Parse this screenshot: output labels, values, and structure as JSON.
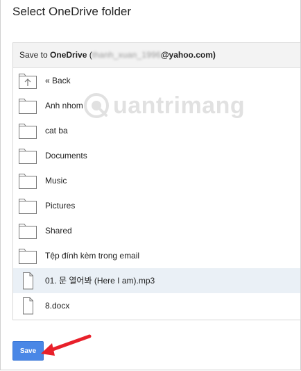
{
  "dialog": {
    "title": "Select OneDrive folder"
  },
  "header": {
    "prefix": "Save to ",
    "service": "OneDrive",
    "account_open": " (",
    "account_hidden": "thanh_xuan_1996",
    "account_domain": "@yahoo.com)"
  },
  "watermark": {
    "text": "uantrimang"
  },
  "items": [
    {
      "label": "« Back",
      "type": "back"
    },
    {
      "label": "Anh nhom",
      "type": "folder"
    },
    {
      "label": "cat ba",
      "type": "folder"
    },
    {
      "label": "Documents",
      "type": "folder"
    },
    {
      "label": "Music",
      "type": "folder"
    },
    {
      "label": "Pictures",
      "type": "folder"
    },
    {
      "label": "Shared",
      "type": "folder"
    },
    {
      "label": "Tệp đính kèm trong email",
      "type": "folder"
    },
    {
      "label": "01. 문 열어봐 (Here I am).mp3",
      "type": "file"
    },
    {
      "label": "8.docx",
      "type": "file"
    }
  ],
  "footer": {
    "save_label": "Save"
  },
  "colors": {
    "accent": "#4a87e6",
    "arrow": "#e8202a",
    "highlight_row": "#eaf0f6"
  }
}
